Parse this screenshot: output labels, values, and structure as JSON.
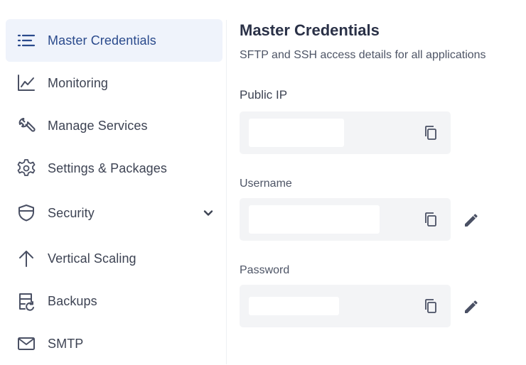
{
  "sidebar": {
    "items": [
      {
        "label": "Master Credentials",
        "icon": "list-icon",
        "active": true
      },
      {
        "label": "Monitoring",
        "icon": "chart-line-icon"
      },
      {
        "label": "Manage Services",
        "icon": "wrench-icon"
      },
      {
        "label": "Settings & Packages",
        "icon": "gear-icon"
      },
      {
        "label": "Security",
        "icon": "shield-icon",
        "expandable": true
      },
      {
        "label": "Vertical Scaling",
        "icon": "arrow-up-icon"
      },
      {
        "label": "Backups",
        "icon": "backup-icon"
      },
      {
        "label": "SMTP",
        "icon": "mail-icon"
      }
    ]
  },
  "main": {
    "title": "Master Credentials",
    "subtitle": "SFTP and SSH access details for all applications",
    "fields": [
      {
        "label": "Public IP",
        "value": "",
        "copy_icon": "copy-icon"
      },
      {
        "label": "Username",
        "value": "",
        "copy_icon": "copy-icon",
        "edit_icon": "pencil-icon"
      },
      {
        "label": "Password",
        "value": "",
        "copy_icon": "copy-icon",
        "edit_icon": "pencil-icon"
      }
    ]
  },
  "colors": {
    "active_bg": "#eff3fb",
    "active_text": "#2a4a8c",
    "text": "#3d4353",
    "field_bg": "#f3f4f6",
    "icon": "#4a5064"
  }
}
